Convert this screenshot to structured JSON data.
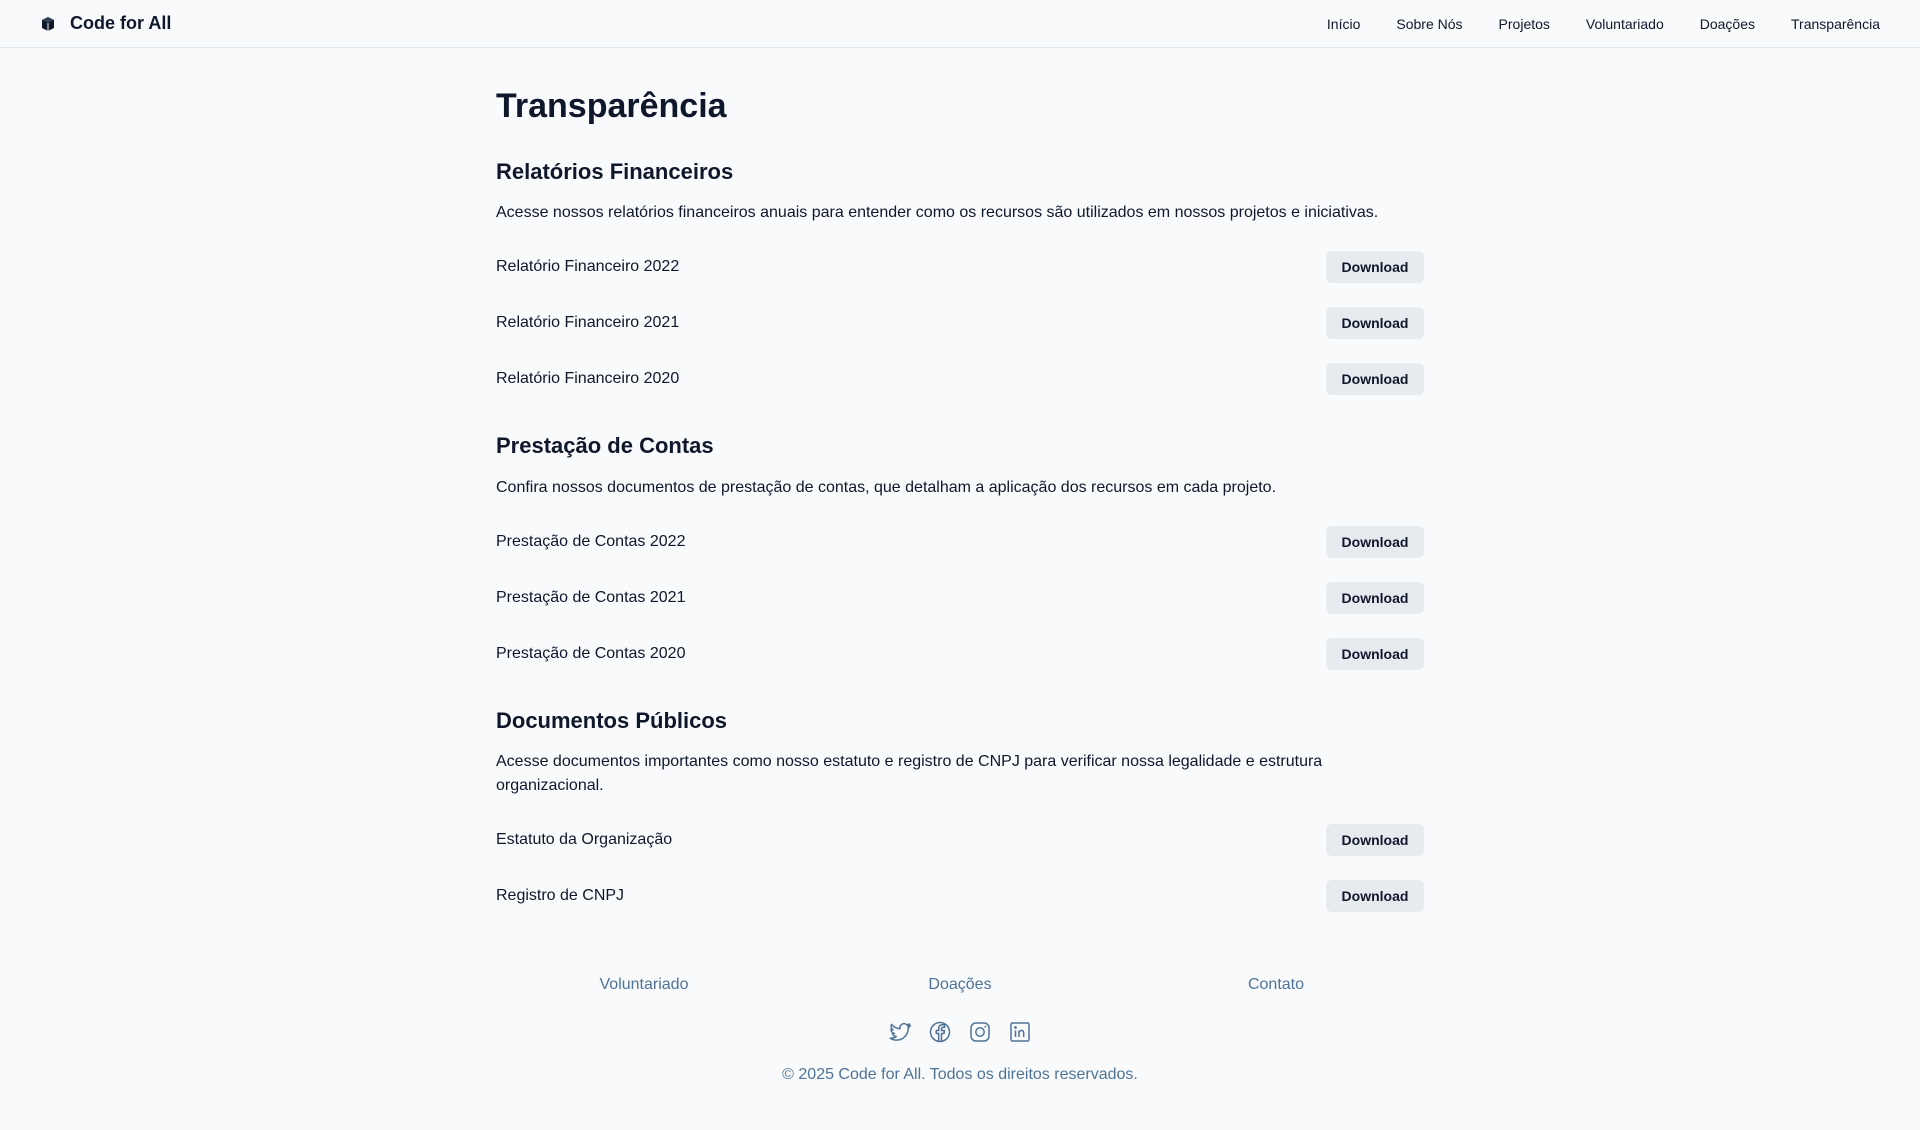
{
  "header": {
    "brand": "Code for All",
    "nav": [
      "Início",
      "Sobre Nós",
      "Projetos",
      "Voluntariado",
      "Doações",
      "Transparência"
    ]
  },
  "page": {
    "title": "Transparência"
  },
  "sections": [
    {
      "title": "Relatórios Financeiros",
      "description": "Acesse nossos relatórios financeiros anuais para entender como os recursos são utilizados em nossos projetos e iniciativas.",
      "documents": [
        {
          "name": "Relatório Financeiro 2022",
          "action": "Download"
        },
        {
          "name": "Relatório Financeiro 2021",
          "action": "Download"
        },
        {
          "name": "Relatório Financeiro 2020",
          "action": "Download"
        }
      ]
    },
    {
      "title": "Prestação de Contas",
      "description": "Confira nossos documentos de prestação de contas, que detalham a aplicação dos recursos em cada projeto.",
      "documents": [
        {
          "name": "Prestação de Contas 2022",
          "action": "Download"
        },
        {
          "name": "Prestação de Contas 2021",
          "action": "Download"
        },
        {
          "name": "Prestação de Contas 2020",
          "action": "Download"
        }
      ]
    },
    {
      "title": "Documentos Públicos",
      "description": "Acesse documentos importantes como nosso estatuto e registro de CNPJ para verificar nossa legalidade e estrutura organizacional.",
      "documents": [
        {
          "name": "Estatuto da Organização",
          "action": "Download"
        },
        {
          "name": "Registro de CNPJ",
          "action": "Download"
        }
      ]
    }
  ],
  "footer": {
    "links": [
      "Voluntariado",
      "Doações",
      "Contato"
    ],
    "social": [
      "twitter-icon",
      "facebook-icon",
      "instagram-icon",
      "linkedin-icon"
    ],
    "copyright": "© 2025 Code for All. Todos os direitos reservados."
  },
  "colors": {
    "background": "#f8fafc",
    "text": "#0f172a",
    "button_bg": "#e7ebf0",
    "footer_link": "#4f7396"
  }
}
